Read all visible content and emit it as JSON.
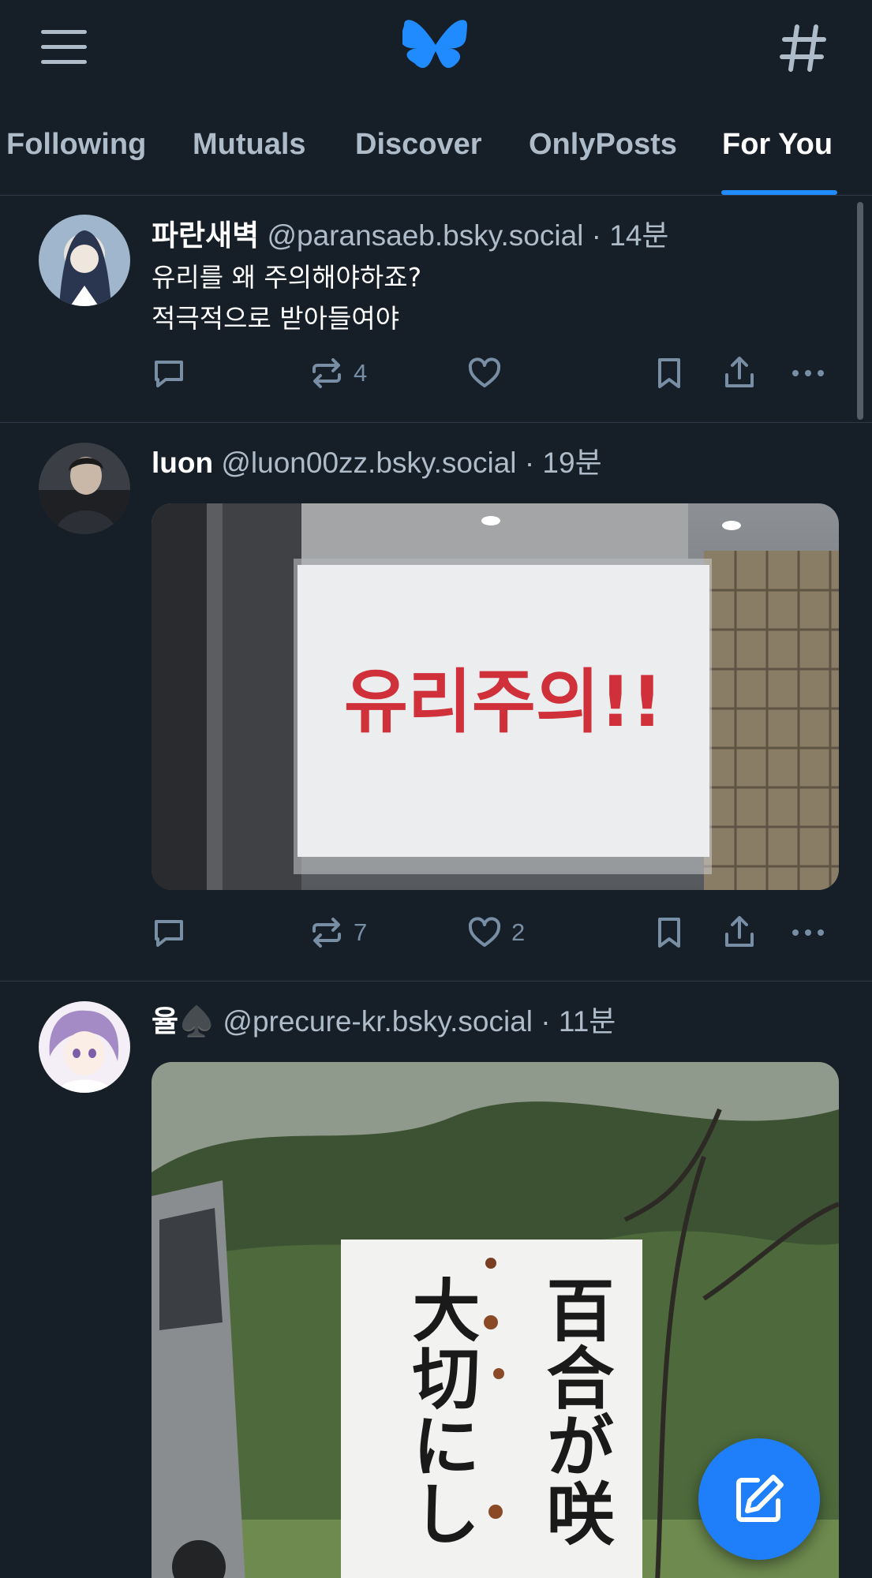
{
  "feed_tabs": [
    {
      "label": "Following",
      "active": false
    },
    {
      "label": "Mutuals",
      "active": false
    },
    {
      "label": "Discover",
      "active": false
    },
    {
      "label": "OnlyPosts",
      "active": false
    },
    {
      "label": "For You",
      "active": true
    }
  ],
  "colors": {
    "background": "#161e27",
    "accent": "#208bfe",
    "muted_text": "#aebbc9",
    "divider": "#2e3a48",
    "fab": "#1f7ffb"
  },
  "icons": {
    "menu": "hamburger-icon",
    "logo": "bluesky-butterfly-icon",
    "feeds": "hashtag-icon",
    "reply": "speech-bubble-icon",
    "repost": "repost-arrows-icon",
    "like": "heart-icon",
    "bookmark": "bookmark-icon",
    "share": "share-upload-icon",
    "more": "ellipsis-icon",
    "compose": "pencil-square-icon"
  },
  "posts": [
    {
      "display_name": "파란새벽",
      "handle": "@paransaeb.bsky.social",
      "time": " · 14분",
      "text": "유리를 왜 주의해야하죠?\n적극적으로 받아들여야",
      "reply_count": "",
      "repost_count": "4",
      "like_count": "",
      "image": null
    },
    {
      "display_name": "luon",
      "handle": "@luon00zz.bsky.social",
      "time": " · 19분",
      "text": "",
      "reply_count": "",
      "repost_count": "7",
      "like_count": "2",
      "image": {
        "sign_text": "유리주의!!"
      }
    },
    {
      "display_name": "율♠️",
      "handle": "@precure-kr.bsky.social",
      "time": " · 11분",
      "text": "",
      "image": {
        "sign_col_right": "百合が咲",
        "sign_col_left": "大切にし"
      }
    }
  ]
}
